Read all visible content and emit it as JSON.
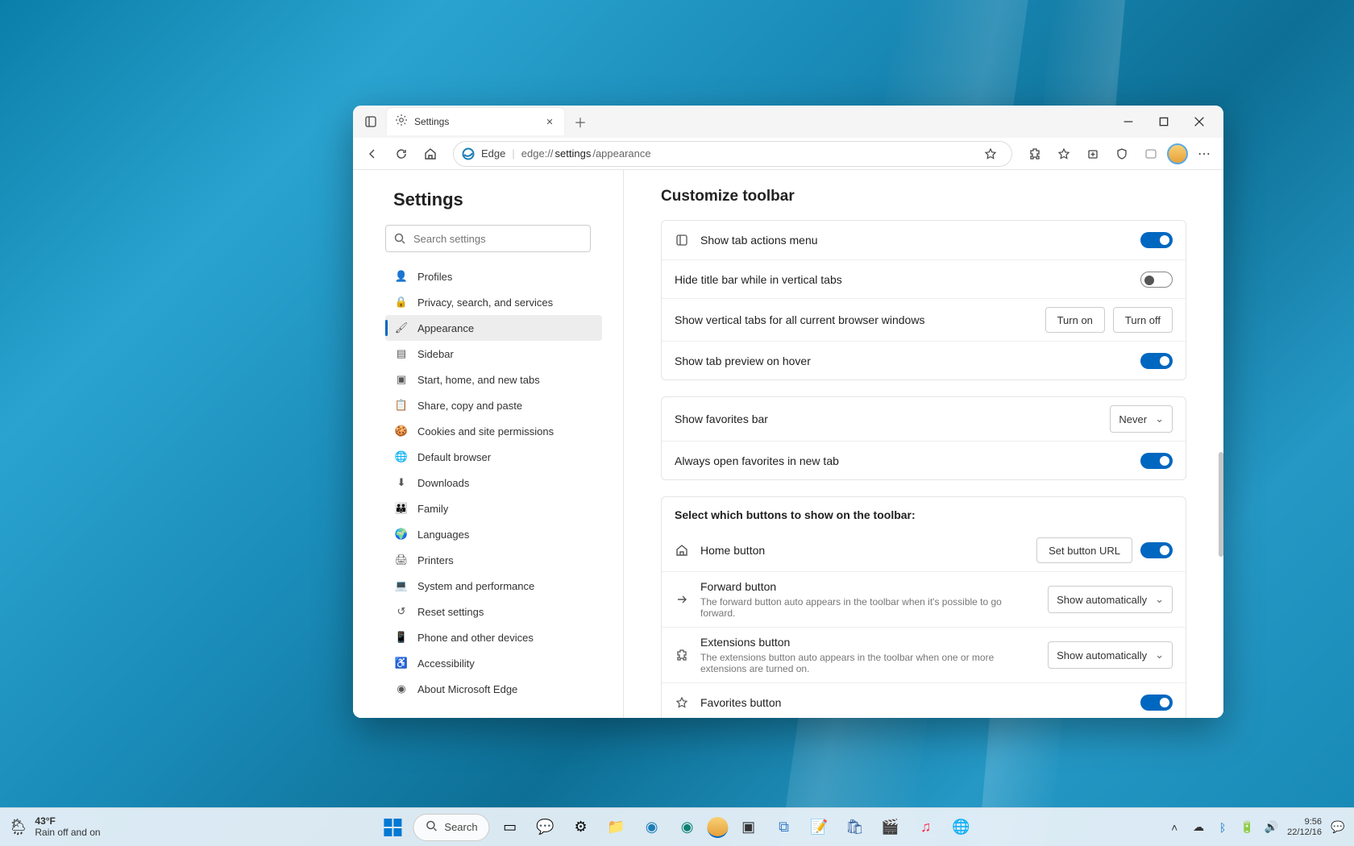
{
  "browser": {
    "tab_title": "Settings",
    "address_label": "Edge",
    "address_prefix": "edge://",
    "address_bold": "settings",
    "address_suffix": "/appearance"
  },
  "sidebar": {
    "title": "Settings",
    "search_placeholder": "Search settings",
    "items": [
      {
        "label": "Profiles"
      },
      {
        "label": "Privacy, search, and services"
      },
      {
        "label": "Appearance"
      },
      {
        "label": "Sidebar"
      },
      {
        "label": "Start, home, and new tabs"
      },
      {
        "label": "Share, copy and paste"
      },
      {
        "label": "Cookies and site permissions"
      },
      {
        "label": "Default browser"
      },
      {
        "label": "Downloads"
      },
      {
        "label": "Family"
      },
      {
        "label": "Languages"
      },
      {
        "label": "Printers"
      },
      {
        "label": "System and performance"
      },
      {
        "label": "Reset settings"
      },
      {
        "label": "Phone and other devices"
      },
      {
        "label": "Accessibility"
      },
      {
        "label": "About Microsoft Edge"
      }
    ]
  },
  "main": {
    "heading": "Customize toolbar",
    "tab_actions": "Show tab actions menu",
    "hide_titlebar": "Hide title bar while in vertical tabs",
    "vertical_tabs_all": "Show vertical tabs for all current browser windows",
    "turn_on": "Turn on",
    "turn_off": "Turn off",
    "tab_preview": "Show tab preview on hover",
    "favorites_bar": "Show favorites bar",
    "favorites_bar_value": "Never",
    "favorites_newtab": "Always open favorites in new tab",
    "select_buttons": "Select which buttons to show on the toolbar:",
    "home_button": "Home button",
    "set_url": "Set button URL",
    "forward_button": "Forward button",
    "forward_desc": "The forward button auto appears in the toolbar when it's possible to go forward.",
    "show_auto": "Show automatically",
    "extensions_button": "Extensions button",
    "extensions_desc": "The extensions button auto appears in the toolbar when one or more extensions are turned on.",
    "favorites_button": "Favorites button"
  },
  "taskbar": {
    "weather_temp": "43°F",
    "weather_cond": "Rain off and on",
    "search_label": "Search",
    "time": "9:56",
    "date": "22/12/16"
  }
}
